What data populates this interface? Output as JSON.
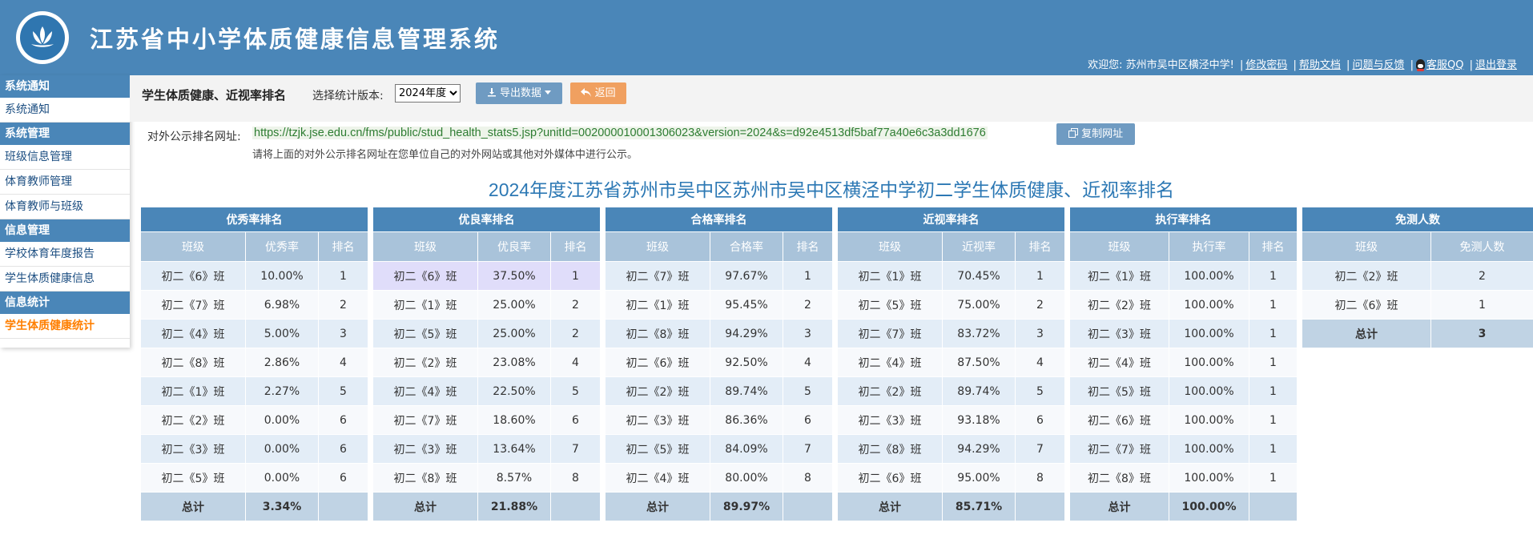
{
  "header": {
    "app_title": "江苏省中小学体质健康信息管理系统",
    "welcome": "欢迎您: 苏州市吴中区横泾中学!",
    "links": {
      "change_pwd": "修改密码",
      "help": "帮助文档",
      "feedback": "问题与反馈",
      "qq": "客服QQ",
      "logout": "退出登录"
    },
    "separator": "|",
    "color": "#4a86b8"
  },
  "sidebar": {
    "groups": [
      {
        "title": "系统通知",
        "items": [
          "系统通知"
        ]
      },
      {
        "title": "系统管理",
        "items": [
          "班级信息管理",
          "体育教师管理",
          "体育教师与班级"
        ]
      },
      {
        "title": "信息管理",
        "items": [
          "学校体育年度报告",
          "学生体质健康信息"
        ]
      },
      {
        "title": "信息统计",
        "items": [
          "学生体质健康统计"
        ]
      }
    ],
    "active_item": "学生体质健康统计"
  },
  "toolbar": {
    "page_title": "学生体质健康、近视率排名",
    "version_label": "选择统计版本:",
    "version_value": "2024年度",
    "export_label": "导出数据",
    "back_label": "返回",
    "url_label": "对外公示排名网址:",
    "url": "https://tzjk.jse.edu.cn/fms/public/stud_health_stats5.jsp?unitId=002000010001306023&version=2024&s=d92e4513df5baf77a40e6c3a3dd1676",
    "copy_label": "复制网址",
    "url_tip": "请将上面的对外公示排名网址在您单位自己的对外网站或其他对外媒体中进行公示。"
  },
  "report_title": "2024年度江苏省苏州市吴中区苏州市吴中区横泾中学初二学生体质健康、近视率排名",
  "tables": {
    "excellent": {
      "caption": "优秀率排名",
      "col_class": "班级",
      "col_rate": "优秀率",
      "col_rank": "排名",
      "rows": [
        {
          "cls": "初二《6》班",
          "rate": "10.00%",
          "rank": "1"
        },
        {
          "cls": "初二《7》班",
          "rate": "6.98%",
          "rank": "2"
        },
        {
          "cls": "初二《4》班",
          "rate": "5.00%",
          "rank": "3"
        },
        {
          "cls": "初二《8》班",
          "rate": "2.86%",
          "rank": "4"
        },
        {
          "cls": "初二《1》班",
          "rate": "2.27%",
          "rank": "5"
        },
        {
          "cls": "初二《2》班",
          "rate": "0.00%",
          "rank": "6"
        },
        {
          "cls": "初二《3》班",
          "rate": "0.00%",
          "rank": "6"
        },
        {
          "cls": "初二《5》班",
          "rate": "0.00%",
          "rank": "6"
        }
      ],
      "total_label": "总计",
      "total_value": "3.34%"
    },
    "good": {
      "caption": "优良率排名",
      "col_class": "班级",
      "col_rate": "优良率",
      "col_rank": "排名",
      "rows": [
        {
          "cls": "初二《6》班",
          "rate": "37.50%",
          "rank": "1"
        },
        {
          "cls": "初二《1》班",
          "rate": "25.00%",
          "rank": "2"
        },
        {
          "cls": "初二《5》班",
          "rate": "25.00%",
          "rank": "2"
        },
        {
          "cls": "初二《2》班",
          "rate": "23.08%",
          "rank": "4"
        },
        {
          "cls": "初二《4》班",
          "rate": "22.50%",
          "rank": "5"
        },
        {
          "cls": "初二《7》班",
          "rate": "18.60%",
          "rank": "6"
        },
        {
          "cls": "初二《3》班",
          "rate": "13.64%",
          "rank": "7"
        },
        {
          "cls": "初二《8》班",
          "rate": "8.57%",
          "rank": "8"
        }
      ],
      "total_label": "总计",
      "total_value": "21.88%"
    },
    "pass": {
      "caption": "合格率排名",
      "col_class": "班级",
      "col_rate": "合格率",
      "col_rank": "排名",
      "rows": [
        {
          "cls": "初二《7》班",
          "rate": "97.67%",
          "rank": "1"
        },
        {
          "cls": "初二《1》班",
          "rate": "95.45%",
          "rank": "2"
        },
        {
          "cls": "初二《8》班",
          "rate": "94.29%",
          "rank": "3"
        },
        {
          "cls": "初二《6》班",
          "rate": "92.50%",
          "rank": "4"
        },
        {
          "cls": "初二《2》班",
          "rate": "89.74%",
          "rank": "5"
        },
        {
          "cls": "初二《3》班",
          "rate": "86.36%",
          "rank": "6"
        },
        {
          "cls": "初二《5》班",
          "rate": "84.09%",
          "rank": "7"
        },
        {
          "cls": "初二《4》班",
          "rate": "80.00%",
          "rank": "8"
        }
      ],
      "total_label": "总计",
      "total_value": "89.97%"
    },
    "myopia": {
      "caption": "近视率排名",
      "col_class": "班级",
      "col_rate": "近视率",
      "col_rank": "排名",
      "rows": [
        {
          "cls": "初二《1》班",
          "rate": "70.45%",
          "rank": "1"
        },
        {
          "cls": "初二《5》班",
          "rate": "75.00%",
          "rank": "2"
        },
        {
          "cls": "初二《7》班",
          "rate": "83.72%",
          "rank": "3"
        },
        {
          "cls": "初二《4》班",
          "rate": "87.50%",
          "rank": "4"
        },
        {
          "cls": "初二《2》班",
          "rate": "89.74%",
          "rank": "5"
        },
        {
          "cls": "初二《3》班",
          "rate": "93.18%",
          "rank": "6"
        },
        {
          "cls": "初二《8》班",
          "rate": "94.29%",
          "rank": "7"
        },
        {
          "cls": "初二《6》班",
          "rate": "95.00%",
          "rank": "8"
        }
      ],
      "total_label": "总计",
      "total_value": "85.71%"
    },
    "execution": {
      "caption": "执行率排名",
      "col_class": "班级",
      "col_rate": "执行率",
      "col_rank": "排名",
      "rows": [
        {
          "cls": "初二《1》班",
          "rate": "100.00%",
          "rank": "1"
        },
        {
          "cls": "初二《2》班",
          "rate": "100.00%",
          "rank": "1"
        },
        {
          "cls": "初二《3》班",
          "rate": "100.00%",
          "rank": "1"
        },
        {
          "cls": "初二《4》班",
          "rate": "100.00%",
          "rank": "1"
        },
        {
          "cls": "初二《5》班",
          "rate": "100.00%",
          "rank": "1"
        },
        {
          "cls": "初二《6》班",
          "rate": "100.00%",
          "rank": "1"
        },
        {
          "cls": "初二《7》班",
          "rate": "100.00%",
          "rank": "1"
        },
        {
          "cls": "初二《8》班",
          "rate": "100.00%",
          "rank": "1"
        }
      ],
      "total_label": "总计",
      "total_value": "100.00%"
    },
    "exempt": {
      "caption": "免测人数",
      "col_class": "班级",
      "col_count": "免测人数",
      "rows": [
        {
          "cls": "初二《2》班",
          "count": "2"
        },
        {
          "cls": "初二《6》班",
          "count": "1"
        }
      ],
      "total_label": "总计",
      "total_value": "3"
    }
  }
}
